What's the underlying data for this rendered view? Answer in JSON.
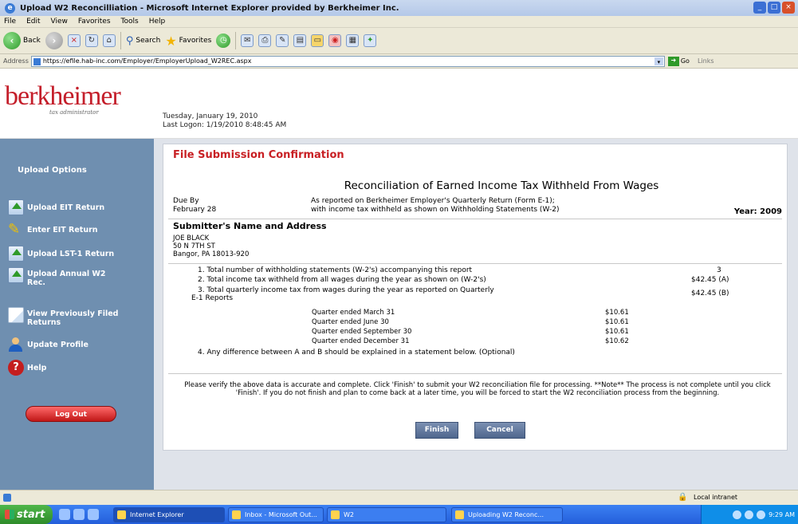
{
  "window": {
    "title": "Upload W2 Reconcilliation - Microsoft Internet Explorer provided by Berkheimer Inc."
  },
  "menu": [
    "File",
    "Edit",
    "View",
    "Favorites",
    "Tools",
    "Help"
  ],
  "toolbar": {
    "back": "Back",
    "search": "Search",
    "favorites": "Favorites"
  },
  "address": {
    "label": "Address",
    "url": "https://efile.hab-inc.com/Employer/EmployerUpload_W2REC.aspx",
    "go": "Go",
    "links": "Links"
  },
  "header": {
    "logo": "berkheimer",
    "tagline": "tax administrator",
    "date": "Tuesday, January 19, 2010",
    "last_logon": "Last Logon: 1/19/2010 8:48:45 AM"
  },
  "sidebar": {
    "title": "Upload Options",
    "items": [
      {
        "label": "Upload EIT Return",
        "icon": "upload-icon"
      },
      {
        "label": "Enter EIT Return",
        "icon": "pencil-icon"
      },
      {
        "label": "Upload LST-1 Return",
        "icon": "upload-icon"
      },
      {
        "label": "Upload Annual W2 Rec.",
        "icon": "upload-icon"
      },
      {
        "label": "View Previously Filed Returns",
        "icon": "document-icon"
      },
      {
        "label": "Update Profile",
        "icon": "user-icon"
      },
      {
        "label": "Help",
        "icon": "help-icon"
      }
    ],
    "logout": "Log Out"
  },
  "main": {
    "section_title": "File Submission Confirmation",
    "report_title": "Reconciliation of Earned Income Tax Withheld From Wages",
    "due_by_label": "Due By",
    "due_by_date": "February 28",
    "as_reported_1": "As reported on Berkheimer Employer's Quarterly Return (Form E-1);",
    "as_reported_2": "with income tax withheld as shown on Withholding Statements (W-2)",
    "year": "Year: 2009",
    "submitter_heading": "Submitter's Name and Address",
    "submitter": {
      "name": "JOE BLACK",
      "street": "50 N 7TH ST",
      "city": "Bangor, PA 18013-920"
    },
    "lines": [
      {
        "text": "1. Total number of withholding statements (W-2's) accompanying this report",
        "value": "3"
      },
      {
        "text": "2. Total income tax withheld from all wages during the year as shown on (W-2's)",
        "value": "$42.45 (A)"
      },
      {
        "text": "3. Total quarterly income tax from wages during the year as reported on Quarterly E-1 Reports",
        "value": "$42.45 (B)"
      }
    ],
    "quarters": [
      {
        "label": "Quarter ended March 31",
        "value": "$10.61"
      },
      {
        "label": "Quarter ended June 30",
        "value": "$10.61"
      },
      {
        "label": "Quarter ended September 30",
        "value": "$10.61"
      },
      {
        "label": "Quarter ended December 31",
        "value": "$10.62"
      }
    ],
    "line4": "4. Any difference between A and B should be explained in a statement below. (Optional)",
    "note": "Please verify the above data is accurate and complete. Click 'Finish' to submit your W2 reconciliation file for processing. **Note** The process is not complete until you click 'Finish'. If you do not finish and plan to come back at a later time, you will be forced to start the W2 reconciliation process from the beginning.",
    "finish": "Finish",
    "cancel": "Cancel"
  },
  "status": {
    "zone": "Local intranet"
  },
  "taskbar": {
    "start": "start",
    "tasks": [
      "Internet Explorer",
      "Inbox - Microsoft Out...",
      "W2",
      "Uploading W2 Reconc..."
    ],
    "clock": "9:29 AM"
  }
}
